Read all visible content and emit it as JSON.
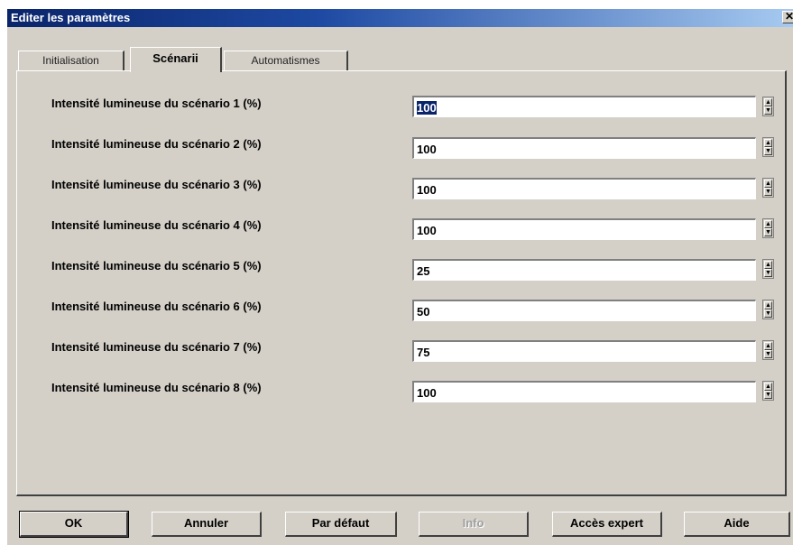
{
  "window": {
    "title": "Editer les paramètres",
    "close_glyph": "✕"
  },
  "tabs": [
    {
      "label": "Initialisation",
      "active": false
    },
    {
      "label": "Scénarii",
      "active": true
    },
    {
      "label": "Automatismes",
      "active": false
    }
  ],
  "rows": [
    {
      "label": "Intensité lumineuse du scénario 1 (%)",
      "value": "100"
    },
    {
      "label": "Intensité lumineuse du scénario 2 (%)",
      "value": "100"
    },
    {
      "label": "Intensité lumineuse du scénario 3 (%)",
      "value": "100"
    },
    {
      "label": "Intensité lumineuse du scénario 4 (%)",
      "value": "100"
    },
    {
      "label": "Intensité lumineuse du scénario 5 (%)",
      "value": "25"
    },
    {
      "label": "Intensité lumineuse du scénario 6 (%)",
      "value": "50"
    },
    {
      "label": "Intensité lumineuse du scénario 7 (%)",
      "value": "75"
    },
    {
      "label": "Intensité lumineuse du scénario 8 (%)",
      "value": "100"
    }
  ],
  "spin_glyphs": {
    "up": "▲",
    "down": "▼"
  },
  "buttons": {
    "ok": "OK",
    "cancel": "Annuler",
    "default": "Par défaut",
    "info": "Info",
    "expert": "Accès expert",
    "help": "Aide"
  },
  "colors": {
    "title_gradient_start": "#0a246a",
    "title_gradient_end": "#a6caf0",
    "face": "#d4d0c8",
    "selection": "#0a246a"
  }
}
